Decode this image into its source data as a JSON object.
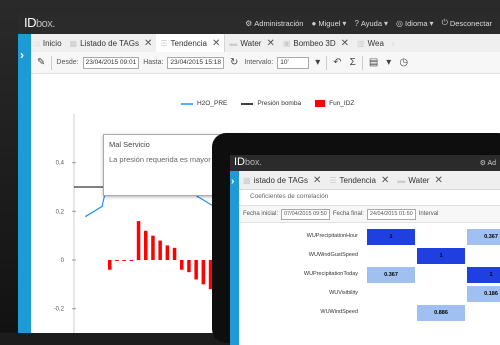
{
  "colors": {
    "accent": "#1e9ad6",
    "bar": "#ff0000",
    "line": "#1e90ff",
    "dark": "#2b2b2b",
    "cell_dark": "#1f3fe0",
    "cell_light": "#9fc0f0"
  },
  "app": {
    "logo_main": "ID",
    "logo_sub": "box",
    "menu": [
      {
        "icon": "gear-icon",
        "label": "Administración"
      },
      {
        "icon": "user-icon",
        "label": "Miguel"
      },
      {
        "icon": "help-icon",
        "label": "Ayuda"
      },
      {
        "icon": "globe-icon",
        "label": "Idioma"
      },
      {
        "icon": "power-icon",
        "label": "Desconectar"
      }
    ],
    "tabs": [
      {
        "icon": "home-icon",
        "label": "Inicio"
      },
      {
        "icon": "table-icon",
        "label": "Listado de TAGs"
      },
      {
        "icon": "trend-icon",
        "label": "Tendencia"
      },
      {
        "icon": "folder-icon",
        "label": "Water"
      },
      {
        "icon": "image-icon",
        "label": "Bombeo 3D"
      },
      {
        "icon": "grid-icon",
        "label": "Wea"
      }
    ],
    "toolbar": {
      "desde_label": "Desde:",
      "desde_value": "23/04/2015 09:01",
      "hasta_label": "Hasta:",
      "hasta_value": "23/04/2015 15:18",
      "intervalo_label": "Intervalo:",
      "intervalo_value": "10'"
    },
    "legend": [
      {
        "label": "H2O_PRE",
        "type": "line"
      },
      {
        "label": "Presión bomba",
        "type": "line"
      },
      {
        "label": "Fun_IDZ",
        "type": "bar"
      }
    ],
    "popup": {
      "title": "Mal Servicio",
      "body": "La presión requerida es mayor"
    }
  },
  "chart_data": {
    "type": "bar",
    "title": "",
    "yticks": [
      "0,4",
      "0,2",
      "0",
      "-0,2"
    ],
    "ylim": [
      -0.3,
      0.6
    ],
    "series": [
      {
        "name": "H2O_PRE",
        "type": "line",
        "values": [
          0.18,
          0.22,
          0.5,
          0.48,
          0.38,
          0.35,
          0.3,
          0.26,
          0.22,
          0.2
        ]
      },
      {
        "name": "Presión bomba",
        "type": "line",
        "values": [
          0.3,
          0.3
        ]
      },
      {
        "name": "Fun_IDZ",
        "type": "bar",
        "values": [
          -0.04,
          0.0,
          0.0,
          0.0,
          0.16,
          0.12,
          0.1,
          0.08,
          0.06,
          0.05,
          -0.04,
          -0.05,
          -0.08,
          -0.1,
          -0.12,
          -0.14,
          -0.16,
          -0.18,
          -0.2,
          -0.22
        ]
      }
    ]
  },
  "tablet": {
    "logo_main": "ID",
    "logo_sub": "box",
    "menu_label": "Ad",
    "tabs": [
      {
        "icon": "table-icon",
        "label": "istado de TAGs"
      },
      {
        "icon": "trend-icon",
        "label": "Tendencia"
      },
      {
        "icon": "folder-icon",
        "label": "Water"
      }
    ],
    "subtitle": "Coeficientes de correlación",
    "fecha_inicial_label": "Fecha inicial:",
    "fecha_inicial_value": "07/04/2015 09:50",
    "fecha_final_label": "Fecha final:",
    "fecha_final_value": "24/04/2015 01:50",
    "interval_label": "Interval",
    "matrix_rows": [
      {
        "label": "WUPrecipitationHour"
      },
      {
        "label": "WUWindGustSpeed"
      },
      {
        "label": "WUPrecipitationToday"
      },
      {
        "label": "WUVisibility"
      },
      {
        "label": "WUWindSpeed"
      }
    ],
    "matrix_cells": [
      {
        "row": 0,
        "col": 0,
        "value": "1",
        "shade": "dark"
      },
      {
        "row": 0,
        "col": 2,
        "value": "0.367",
        "shade": "light"
      },
      {
        "row": 1,
        "col": 1,
        "value": "1",
        "shade": "dark"
      },
      {
        "row": 2,
        "col": 0,
        "value": "0.367",
        "shade": "light"
      },
      {
        "row": 2,
        "col": 2,
        "value": "1",
        "shade": "dark"
      },
      {
        "row": 3,
        "col": 2,
        "value": "0.186",
        "shade": "light"
      },
      {
        "row": 4,
        "col": 1,
        "value": "0.886",
        "shade": "light"
      }
    ]
  }
}
